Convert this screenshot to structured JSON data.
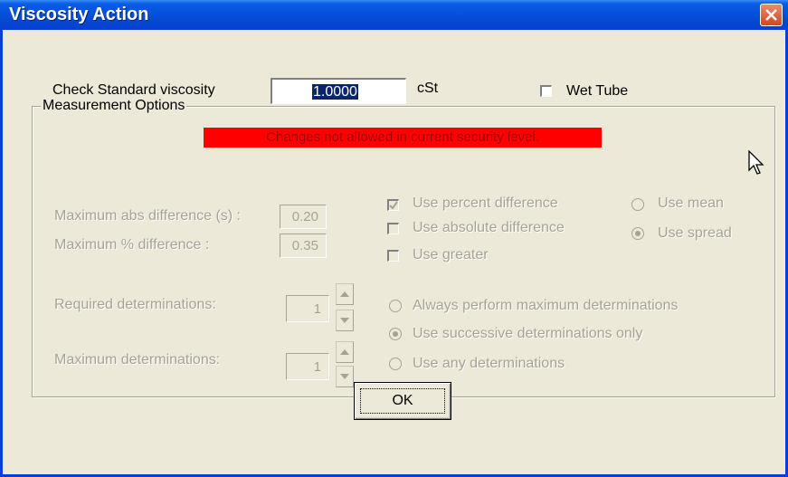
{
  "window": {
    "title": "Viscosity Action"
  },
  "header": {
    "viscosity_label": "Check Standard viscosity",
    "viscosity_value": "1.0000",
    "viscosity_unit": "cSt",
    "wet_tube_label": "Wet Tube",
    "wet_tube_checked": false
  },
  "group": {
    "title": "Measurement Options",
    "banner": "Changes not allowed in current security level.",
    "max_abs_label": "Maximum abs difference (s) :",
    "max_abs_value": "0.20",
    "max_pct_label": "Maximum % difference :",
    "max_pct_value": "0.35",
    "use_percent_label": "Use percent difference",
    "use_percent_checked": true,
    "use_absolute_label": "Use absolute difference",
    "use_absolute_checked": false,
    "use_greater_label": "Use greater",
    "use_greater_checked": false,
    "use_mean_label": "Use mean",
    "use_spread_label": "Use spread",
    "stat_selected": "spread",
    "required_label": "Required determinations:",
    "required_value": "1",
    "maximum_label": "Maximum determinations:",
    "maximum_value": "1",
    "always_max_label": "Always perform maximum determinations",
    "successive_label": "Use successive determinations only",
    "any_label": "Use any determinations",
    "determination_selected": "successive"
  },
  "footer": {
    "ok_label": "OK"
  },
  "colors": {
    "titlebar": "#0a5ce6",
    "banner": "#ff0000",
    "face": "#ece9d8"
  }
}
